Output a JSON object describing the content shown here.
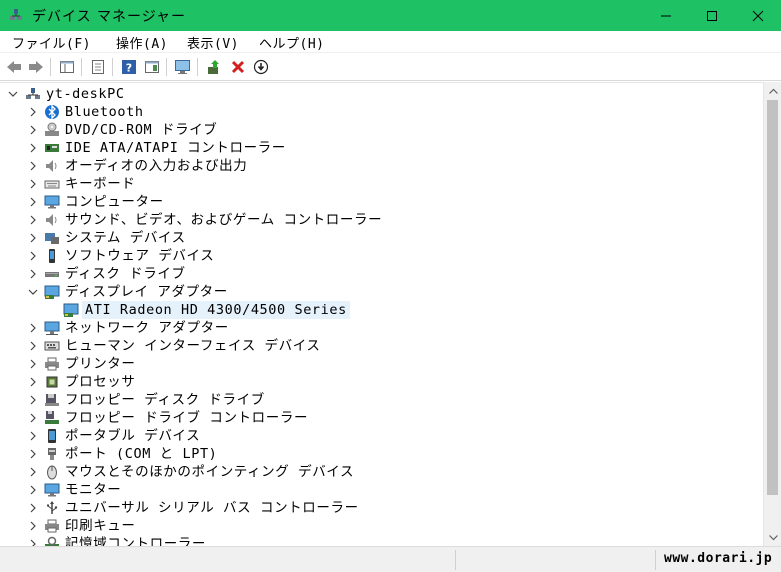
{
  "window": {
    "title": "デバイス マネージャー"
  },
  "menu": [
    {
      "label": "ファイル(F)"
    },
    {
      "label": "操作(A)"
    },
    {
      "label": "表示(V)"
    },
    {
      "label": "ヘルプ(H)"
    }
  ],
  "toolbar": [
    {
      "name": "back-icon"
    },
    {
      "name": "forward-icon"
    },
    {
      "name": "show-hide-console-tree-icon"
    },
    {
      "name": "properties-icon"
    },
    {
      "name": "help-icon"
    },
    {
      "name": "action-pane-icon"
    },
    {
      "name": "scan-hardware-icon"
    },
    {
      "name": "update-driver-icon"
    },
    {
      "name": "uninstall-icon"
    },
    {
      "name": "disable-device-icon"
    }
  ],
  "tree": {
    "root": "yt-deskPC",
    "items": [
      {
        "label": "Bluetooth",
        "icon": "bluetooth-icon",
        "expanded": false
      },
      {
        "label": "DVD/CD-ROM ドライブ",
        "icon": "dvd-drive-icon",
        "expanded": false
      },
      {
        "label": "IDE ATA/ATAPI コントローラー",
        "icon": "ide-controller-icon",
        "expanded": false
      },
      {
        "label": "オーディオの入力および出力",
        "icon": "speaker-icon",
        "expanded": false
      },
      {
        "label": "キーボード",
        "icon": "keyboard-icon",
        "expanded": false
      },
      {
        "label": "コンピューター",
        "icon": "computer-icon",
        "expanded": false
      },
      {
        "label": "サウンド、ビデオ、およびゲーム コントローラー",
        "icon": "speaker-icon",
        "expanded": false
      },
      {
        "label": "システム デバイス",
        "icon": "system-device-icon",
        "expanded": false
      },
      {
        "label": "ソフトウェア デバイス",
        "icon": "software-device-icon",
        "expanded": false
      },
      {
        "label": "ディスク ドライブ",
        "icon": "disk-drive-icon",
        "expanded": false
      },
      {
        "label": "ディスプレイ アダプター",
        "icon": "display-adapter-icon",
        "expanded": true
      },
      {
        "label": "ATI Radeon HD 4300/4500 Series",
        "icon": "display-adapter-icon",
        "child": true,
        "selected": true
      },
      {
        "label": "ネットワーク アダプター",
        "icon": "network-adapter-icon",
        "expanded": false
      },
      {
        "label": "ヒューマン インターフェイス デバイス",
        "icon": "hid-icon",
        "expanded": false
      },
      {
        "label": "プリンター",
        "icon": "printer-icon",
        "expanded": false
      },
      {
        "label": "プロセッサ",
        "icon": "processor-icon",
        "expanded": false
      },
      {
        "label": "フロッピー ディスク ドライブ",
        "icon": "floppy-drive-icon",
        "expanded": false
      },
      {
        "label": "フロッピー ドライブ コントローラー",
        "icon": "floppy-controller-icon",
        "expanded": false
      },
      {
        "label": "ポータブル デバイス",
        "icon": "portable-device-icon",
        "expanded": false
      },
      {
        "label": "ポート (COM と LPT)",
        "icon": "port-icon",
        "expanded": false
      },
      {
        "label": "マウスとそのほかのポインティング デバイス",
        "icon": "mouse-icon",
        "expanded": false
      },
      {
        "label": "モニター",
        "icon": "monitor-icon",
        "expanded": false
      },
      {
        "label": "ユニバーサル シリアル バス コントローラー",
        "icon": "usb-icon",
        "expanded": false
      },
      {
        "label": "印刷キュー",
        "icon": "print-queue-icon",
        "expanded": false
      },
      {
        "label": "記憶域コントローラー",
        "icon": "storage-controller-icon",
        "expanded": false
      }
    ]
  },
  "statusbar": {
    "watermark": "www.dorari.jp"
  },
  "colors": {
    "titlebar": "#1ec264",
    "selection": "#e5f1fb"
  }
}
